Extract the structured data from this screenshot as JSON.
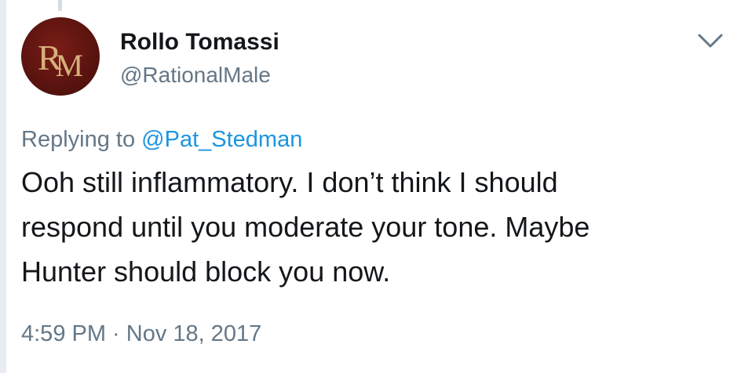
{
  "user": {
    "display_name": "Rollo Tomassi",
    "handle": "@RationalMale",
    "avatar_monogram": "RM"
  },
  "reply": {
    "prefix": "Replying to",
    "mention": "@Pat_Stedman"
  },
  "tweet": {
    "lines": [
      "Ooh still inflammatory. I don’t think I should",
      "respond until you moderate your tone. Maybe",
      "Hunter should block you now."
    ]
  },
  "timestamp": "4:59 PM · Nov 18, 2017",
  "icons": {
    "menu": "chevron-down-icon"
  },
  "colors": {
    "text_primary": "#14171a",
    "text_secondary": "#657786",
    "link": "#1b95e0",
    "avatar_bg": "#5c1410",
    "avatar_fg": "#d7b07c"
  }
}
